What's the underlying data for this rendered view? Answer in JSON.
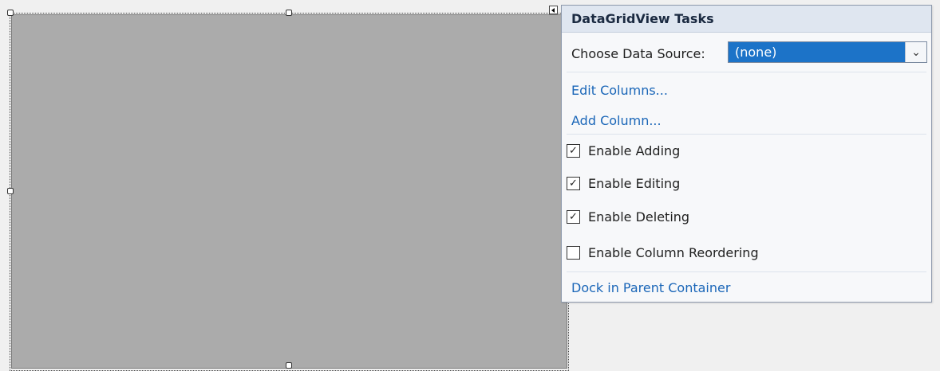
{
  "panel": {
    "title": "DataGridView Tasks",
    "data_source_label": "Choose Data Source:",
    "data_source_value": "(none)",
    "edit_columns": "Edit Columns...",
    "add_column": "Add Column...",
    "options": [
      {
        "label": "Enable Adding",
        "checked": true
      },
      {
        "label": "Enable Editing",
        "checked": true
      },
      {
        "label": "Enable Deleting",
        "checked": true
      },
      {
        "label": "Enable Column Reordering",
        "checked": false
      }
    ],
    "dock": "Dock in Parent Container"
  },
  "icons": {
    "dropdown": "chevron-down-icon",
    "check": "checkmark-icon",
    "smart_tag": "smart-tag-arrow-icon"
  },
  "colors": {
    "grid_background": "#ababab",
    "selection_highlight": "#1c73c8",
    "link": "#1a66b8",
    "panel_header": "#dfe6f0"
  }
}
